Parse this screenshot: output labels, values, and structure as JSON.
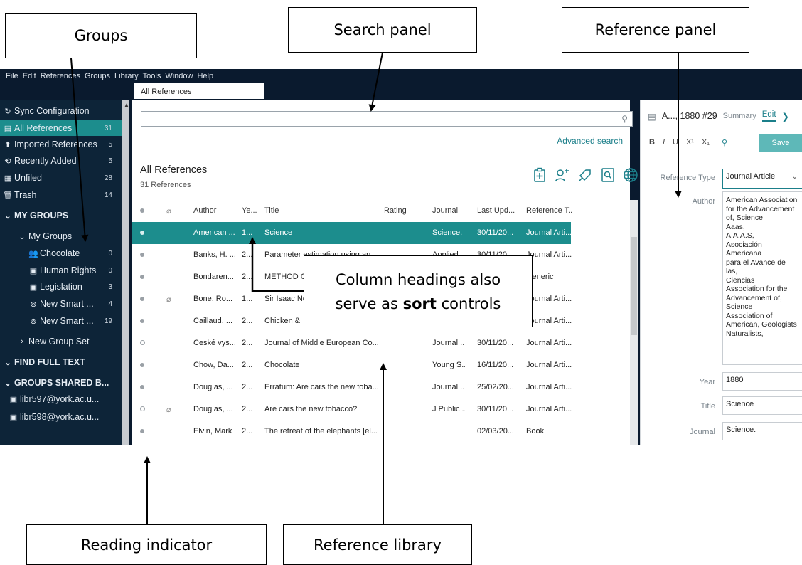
{
  "callouts": {
    "groups": "Groups",
    "search": "Search panel",
    "reference_panel": "Reference panel",
    "column_line1": "Column headings also",
    "column_line2_pre": "serve as ",
    "column_line2_bold": "sort",
    "column_line2_post": " controls",
    "reading": "Reading indicator",
    "library": "Reference library"
  },
  "menu": [
    "File",
    "Edit",
    "References",
    "Groups",
    "Library",
    "Tools",
    "Window",
    "Help"
  ],
  "tab": "All References",
  "sidebar": {
    "items": [
      {
        "icon": "sync-icon",
        "label": "Sync Configuration",
        "count": ""
      },
      {
        "icon": "references-icon",
        "label": "All References",
        "count": "31"
      },
      {
        "icon": "imported-icon",
        "label": "Imported References",
        "count": "5"
      },
      {
        "icon": "recent-icon",
        "label": "Recently Added",
        "count": "5"
      },
      {
        "icon": "unfiled-icon",
        "label": "Unfiled",
        "count": "28"
      },
      {
        "icon": "trash-icon",
        "label": "Trash",
        "count": "14"
      },
      {
        "icon": "chevron-down-icon",
        "label": "MY GROUPS",
        "count": ""
      },
      {
        "icon": "chevron-down-icon",
        "label": "My Groups",
        "count": ""
      },
      {
        "icon": "users-icon",
        "label": "Chocolate",
        "count": "0"
      },
      {
        "icon": "group-icon",
        "label": "Human Rights",
        "count": "0"
      },
      {
        "icon": "group-icon",
        "label": "Legislation",
        "count": "3"
      },
      {
        "icon": "smart-group-icon",
        "label": "New Smart ...",
        "count": "4"
      },
      {
        "icon": "smart-group-icon",
        "label": "New Smart ...",
        "count": "19"
      },
      {
        "icon": "chevron-right-icon",
        "label": "New Group Set",
        "count": ""
      },
      {
        "icon": "chevron-down-icon",
        "label": "FIND FULL TEXT",
        "count": ""
      },
      {
        "icon": "chevron-down-icon",
        "label": "GROUPS SHARED B...",
        "count": ""
      },
      {
        "icon": "shared-group-icon",
        "label": "libr597@york.ac.u...",
        "count": ""
      },
      {
        "icon": "shared-group-icon",
        "label": "libr598@york.ac.u...",
        "count": ""
      }
    ]
  },
  "search": {
    "placeholder": "",
    "advanced": "Advanced search"
  },
  "library": {
    "title": "All References",
    "count": "31 References"
  },
  "table": {
    "headers": {
      "author": "Author",
      "year": "Ye...",
      "title": "Title",
      "rating": "Rating",
      "journal": "Journal",
      "updated": "Last Upd...",
      "type": "Reference T..."
    },
    "rows": [
      {
        "read": "dot",
        "clip": "",
        "author": "American ...",
        "year": "1...",
        "title": "Science",
        "rating": "",
        "journal": "Science.",
        "updated": "30/11/20...",
        "type": "Journal Arti..."
      },
      {
        "read": "dot",
        "clip": "",
        "author": "Banks, H. ...",
        "year": "2...",
        "title": "Parameter estimation using an",
        "rating": "",
        "journal": "Applied",
        "updated": "30/11/20",
        "type": "Journal Arti..."
      },
      {
        "read": "dot",
        "clip": "",
        "author": "Bondaren...",
        "year": "2...",
        "title": "METHOD O",
        "rating": "",
        "journal": "",
        "updated": "",
        "type": "Generic"
      },
      {
        "read": "dot",
        "clip": "paperclip",
        "author": "Bone, Ro...",
        "year": "1...",
        "title": "Sir Isaac Ne",
        "rating": "",
        "journal": "",
        "updated": "",
        "type": "Journal Arti..."
      },
      {
        "read": "dot",
        "clip": "",
        "author": "Caillaud, ...",
        "year": "2...",
        "title": "Chicken &",
        "rating": "",
        "journal": "",
        "updated": "",
        "type": "Journal Arti..."
      },
      {
        "read": "ring",
        "clip": "",
        "author": "České vys...",
        "year": "2...",
        "title": "Journal of Middle European Co...",
        "rating": "",
        "journal": "Journal ...",
        "updated": "30/11/20...",
        "type": "Journal Arti..."
      },
      {
        "read": "dot",
        "clip": "",
        "author": "Chow, Da...",
        "year": "2...",
        "title": "Chocolate",
        "rating": "",
        "journal": "Young S...",
        "updated": "16/11/20...",
        "type": "Journal Arti..."
      },
      {
        "read": "dot",
        "clip": "",
        "author": "Douglas, ...",
        "year": "2...",
        "title": "Erratum: Are cars the new toba...",
        "rating": "",
        "journal": "Journal ...",
        "updated": "25/02/20...",
        "type": "Journal Arti..."
      },
      {
        "read": "ring",
        "clip": "paperclip",
        "author": "Douglas, ...",
        "year": "2...",
        "title": "Are cars the new tobacco?",
        "rating": "",
        "journal": "J Public ...",
        "updated": "30/11/20...",
        "type": "Journal Arti..."
      },
      {
        "read": "dot",
        "clip": "",
        "author": "Elvin, Mark",
        "year": "2...",
        "title": "The retreat of the elephants [el...",
        "rating": "",
        "journal": "",
        "updated": "02/03/20...",
        "type": "Book"
      }
    ]
  },
  "reference": {
    "header": "A..., 1880 #29",
    "summary_tab": "Summary",
    "edit_tab": "Edit",
    "format": [
      "B",
      "I",
      "U",
      "X¹",
      "X₁"
    ],
    "save": "Save",
    "type_label": "Reference Type",
    "type_value": "Journal Article",
    "author_label": "Author",
    "authors": [
      "American Association",
      "for the Advancement",
      "of, Science",
      "Aaas,",
      "A.A.A.S,",
      "Asociación Americana",
      "para el Avance de las,",
      "Ciencias",
      "Association for the",
      "Advancement of,",
      "Science",
      "Association of",
      "American, Geologists",
      "Naturalists,"
    ],
    "year_label": "Year",
    "year_value": "1880",
    "title_label": "Title",
    "title_value": "Science",
    "journal_label": "Journal",
    "journal_value": "Science."
  },
  "colors": {
    "accent": "#1c8d8d",
    "sidebar_bg": "#0d2438",
    "window_bg": "#0a1a2e",
    "link": "#1b7f8a"
  }
}
